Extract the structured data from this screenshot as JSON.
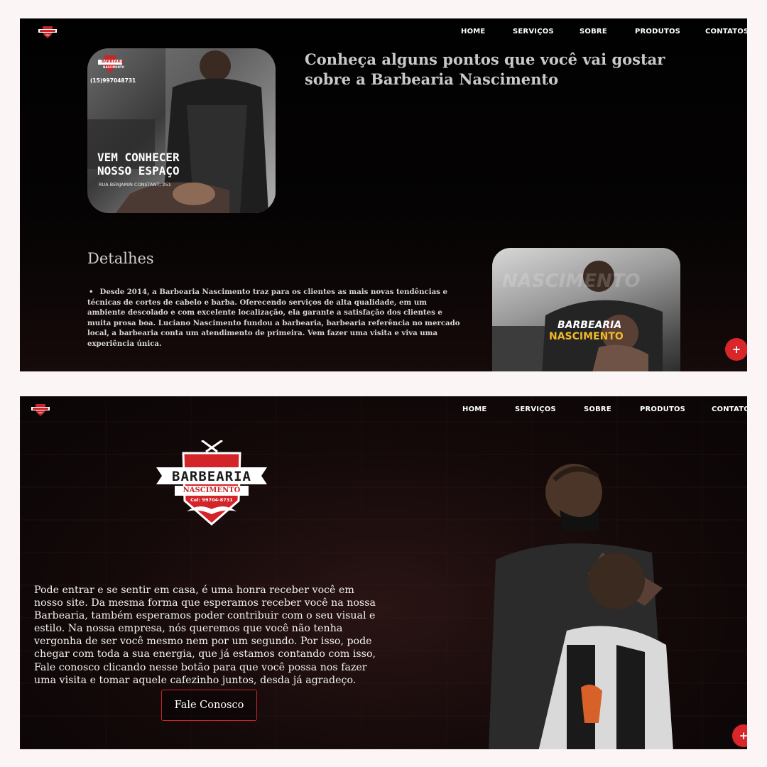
{
  "nav": {
    "items": [
      "HOME",
      "SERVIÇOS",
      "SOBRE",
      "PRODUTOS",
      "CONTATOS"
    ],
    "items_cut": [
      "HOME",
      "SERVIÇOS",
      "SOBRE",
      "PRODUTOS",
      "CONTATO"
    ]
  },
  "section_about": {
    "heading": "Conheça alguns pontos que você vai gostar sobre a Barbearia Nascimento",
    "photo1": {
      "badge_title": "BARBEARIA",
      "badge_sub": "NASCIMENTO",
      "phone": "(15)997048731",
      "line1": "VEM CONHECER",
      "line2": "NOSSO ESPAÇO",
      "address": "RUA BENJAMIN CONSTANT, 251"
    },
    "photo2": {
      "line1": "BARBEARIA",
      "line2": "NASCIMENTO",
      "watermark": "NASCIMENTO"
    },
    "details_title": "Detalhes",
    "details_text": "Desde 2014, a Barbearia Nascimento traz para os clientes as mais novas tendências e técnicas de cortes de cabelo e barba. Oferecendo serviços de alta qualidade, em um ambiente descolado e com excelente localização, ela garante a satisfação dos clientes e muita prosa boa. Luciano Nascimento fundou a barbearia, barbearia referência no mercado local, a barbearia conta um atendimento de primeira. Vem fazer uma visita e viva uma experiência única."
  },
  "section_home": {
    "logo": {
      "title": "BARBEARIA",
      "subtitle": "NASCIMENTO",
      "phone": "Cel: 99704-8731"
    },
    "welcome_text": "Pode entrar e se sentir em casa, é uma honra receber você em nosso site. Da mesma forma que esperamos receber você na nossa Barbearia, também esperamos poder contribuir com o seu visual e estilo. Na nossa empresa, nós queremos que você não tenha vergonha de ser você mesmo nem por um segundo. Por isso, pode chegar com toda a sua energia, que já estamos contando com isso, Fale conosco clicando nesse botão para que você possa nos fazer uma visita e tomar aquele cafezinho juntos, desda já agradeço.",
    "cta_label": "Fale Conosco"
  },
  "fab_label": "+",
  "colors": {
    "accent": "#d8262a",
    "background": "#050303",
    "frame": "#fbf5f5"
  }
}
